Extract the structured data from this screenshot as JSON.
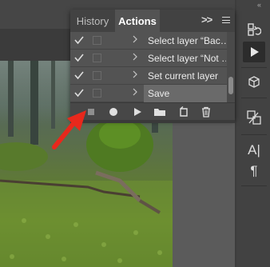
{
  "panel": {
    "tabs": [
      {
        "label": "History",
        "active": false
      },
      {
        "label": "Actions",
        "active": true
      }
    ],
    "more_glyph": ">>"
  },
  "actions": [
    {
      "label": "Select layer “Bac…",
      "checked": true,
      "selected": false
    },
    {
      "label": "Select layer “Not …",
      "checked": true,
      "selected": false
    },
    {
      "label": "Set current layer",
      "checked": true,
      "selected": false
    },
    {
      "label": "Save",
      "checked": true,
      "selected": true
    }
  ],
  "toolbar": {
    "buttons": [
      "stop-icon",
      "record-icon",
      "play-icon",
      "folder-icon",
      "new-action-icon",
      "delete-icon"
    ]
  },
  "dock": {
    "collapse_glyph": "«",
    "character_label": "A|",
    "paragraph_label": "¶",
    "icons": [
      "history-icon",
      "actions-play-icon",
      "3d-icon",
      "clone-source-icon",
      "character-icon",
      "paragraph-icon"
    ],
    "active": "actions-play-icon"
  },
  "colors": {
    "annotation_arrow": "#e8281c",
    "panel_bg": "#535353",
    "selected_row": "#6a6a6a"
  }
}
